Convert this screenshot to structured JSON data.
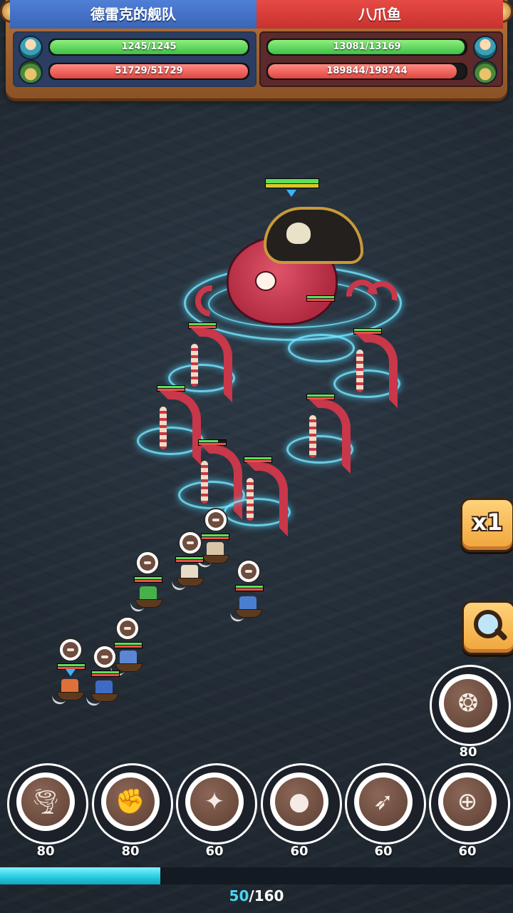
{
  "header": {
    "left_team": {
      "name": "德雷克的舰队",
      "crew_hp": "1245/1245",
      "crew_fraction": 1.0,
      "ship_hp": "51729/51729",
      "ship_fraction": 1.0,
      "color": "#3a64b8"
    },
    "right_team": {
      "name": "八爪鱼",
      "crew_hp": "13081/13169",
      "crew_fraction": 0.993,
      "ship_hp": "189844/198744",
      "ship_fraction": 0.955,
      "color": "#c8322e"
    }
  },
  "controls": {
    "speed_label": "x1",
    "speed_icon": "speed-button",
    "search_icon": "magnifier-icon"
  },
  "skills": {
    "special": {
      "icon": "winged-emblem-icon",
      "cost": "80"
    },
    "bar": [
      {
        "icon": "tornado-icon",
        "cost": "80"
      },
      {
        "icon": "fist-icon",
        "cost": "80"
      },
      {
        "icon": "spikes-icon",
        "cost": "60"
      },
      {
        "icon": "cannonball-icon",
        "cost": "60"
      },
      {
        "icon": "rocket-icon",
        "cost": "60"
      },
      {
        "icon": "crosshair-icon",
        "cost": "60"
      }
    ]
  },
  "energy": {
    "current": "50",
    "separator_max": "/160",
    "fraction": 0.3125
  },
  "colors": {
    "hp_green": "#5ee05a",
    "hp_red": "#e8524b",
    "energy": "#23c8e0",
    "accent_gold": "#f0a43a"
  }
}
